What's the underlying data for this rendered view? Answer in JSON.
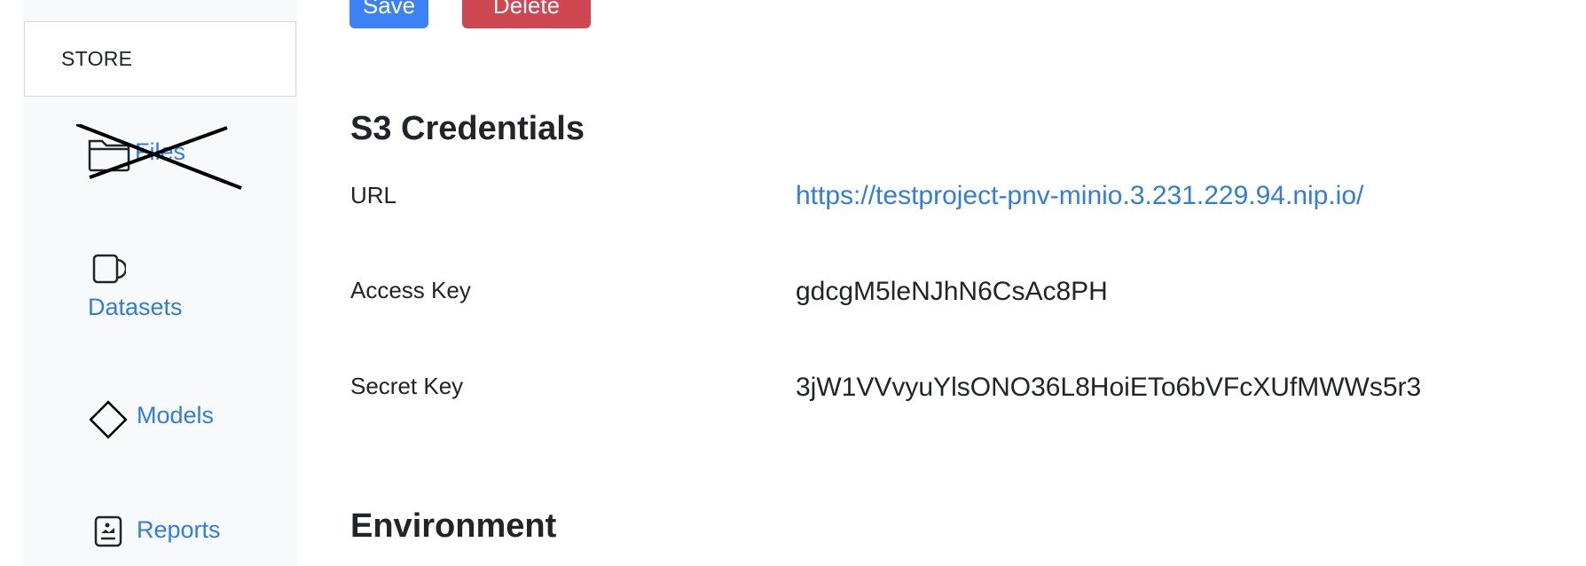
{
  "toolbar": {
    "save_label": "Save",
    "delete_label": "Delete"
  },
  "sidebar": {
    "store_label": "STORE",
    "items": [
      {
        "label": "Files",
        "icon": "folder-icon",
        "crossed_out": true
      },
      {
        "label": "Datasets",
        "icon": "dataset-icon"
      },
      {
        "label": "Models",
        "icon": "diamond-icon"
      },
      {
        "label": "Reports",
        "icon": "report-icon"
      }
    ]
  },
  "credentials": {
    "title": "S3 Credentials",
    "url_label": "URL",
    "url_value": "https://testproject-pnv-minio.3.231.229.94.nip.io/",
    "access_key_label": "Access Key",
    "access_key_value": "gdcgM5leNJhN6CsAc8PH",
    "secret_key_label": "Secret Key",
    "secret_key_value": "3jW1VVvyuYlsONO36L8HoiETo6bVFcXUfMWWs5r3"
  },
  "environment": {
    "title": "Environment"
  },
  "colors": {
    "link": "#2f7de1",
    "save": "#3b82f6",
    "delete": "#cd4650",
    "sidebar_bg": "#f8f9fa"
  }
}
